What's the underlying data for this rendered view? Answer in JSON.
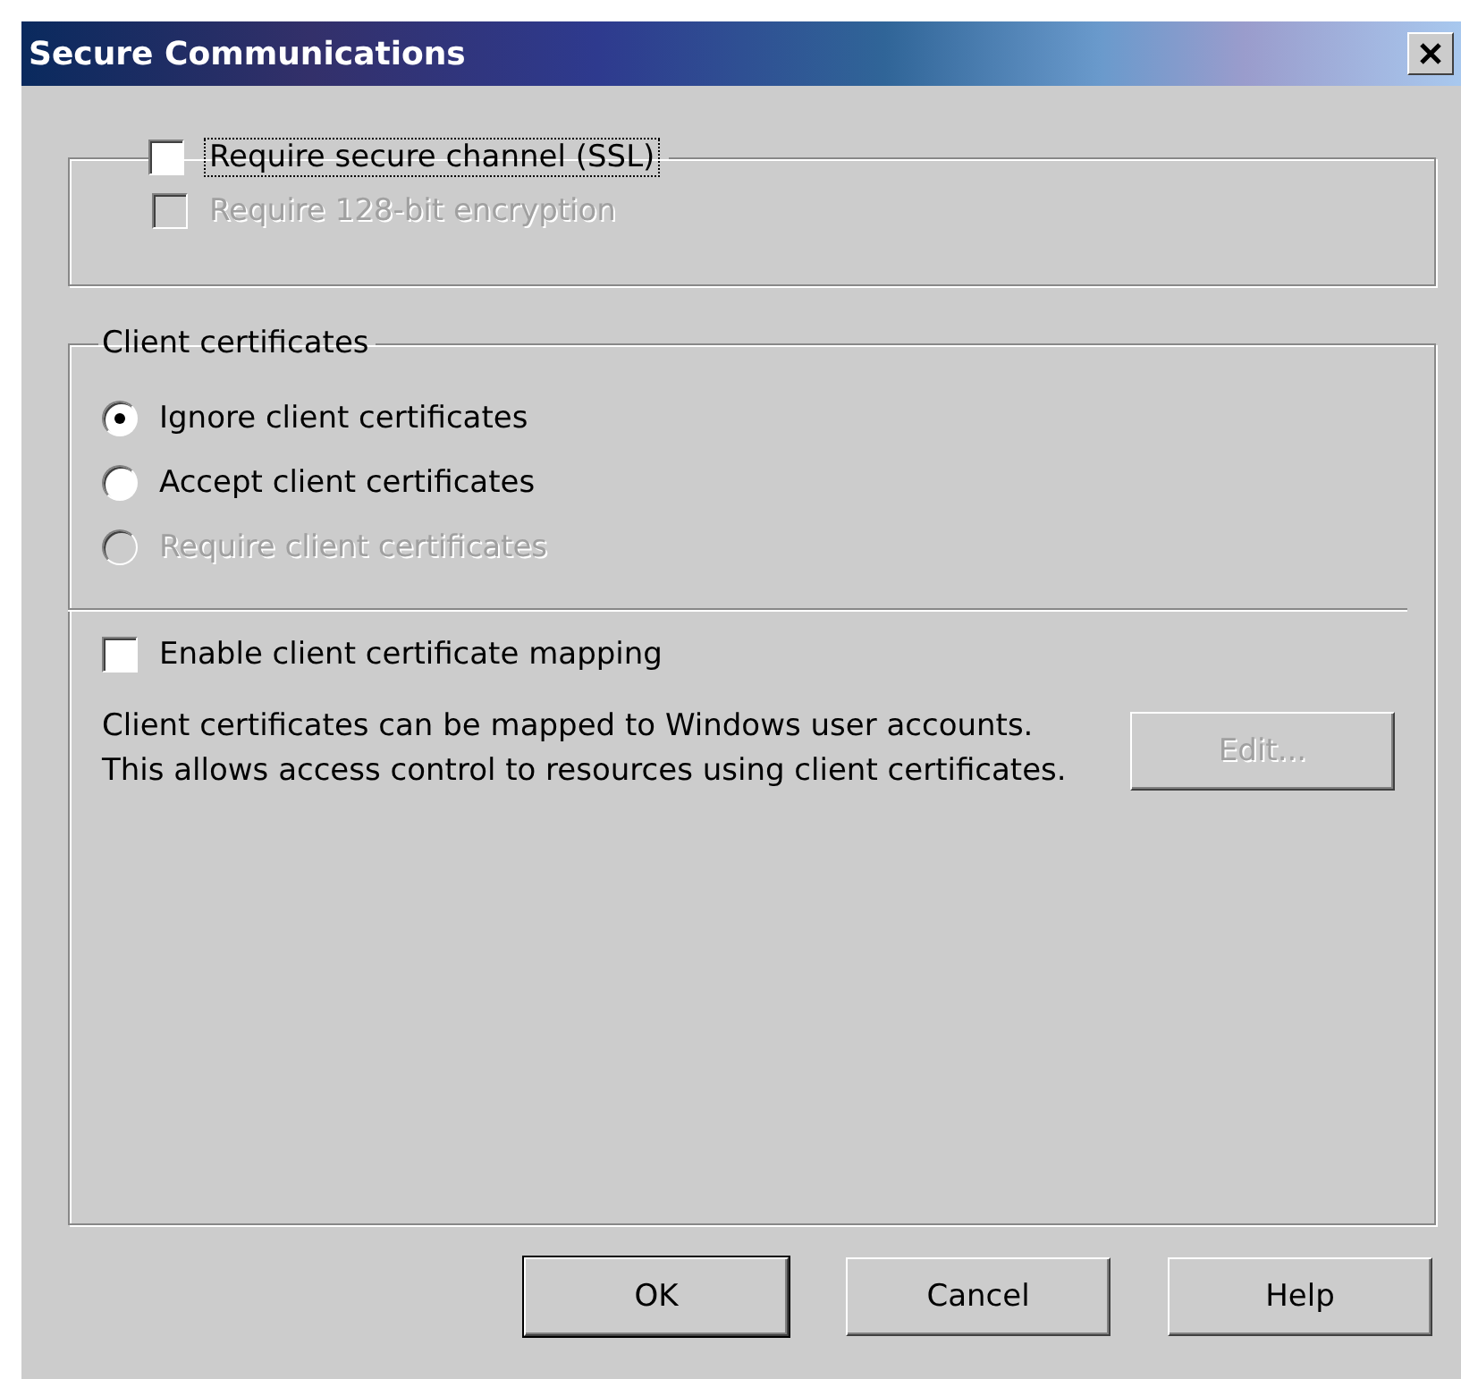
{
  "window": {
    "title": "Secure Communications"
  },
  "ssl_group": {
    "checkbox": {
      "label": "Require secure channel (SSL)",
      "checked": false,
      "focused": true
    },
    "sub_checkbox": {
      "label": "Require 128-bit encryption",
      "checked": false,
      "disabled": true
    }
  },
  "client_certificates": {
    "title": "Client certificates",
    "options": [
      {
        "label": "Ignore client certificates",
        "selected": true,
        "disabled": false
      },
      {
        "label": "Accept client certificates",
        "selected": false,
        "disabled": false
      },
      {
        "label": "Require client certificates",
        "selected": false,
        "disabled": true
      }
    ],
    "mapping": {
      "label": "Enable client certificate mapping",
      "checked": false
    },
    "description": "Client certificates can be mapped to Windows user accounts.  This allows access control to resources using client certificates.",
    "edit_button": {
      "label": "Edit...",
      "disabled": true
    }
  },
  "buttons": [
    {
      "label": "OK",
      "default": true
    },
    {
      "label": "Cancel",
      "default": false
    },
    {
      "label": "Help",
      "default": false
    }
  ]
}
